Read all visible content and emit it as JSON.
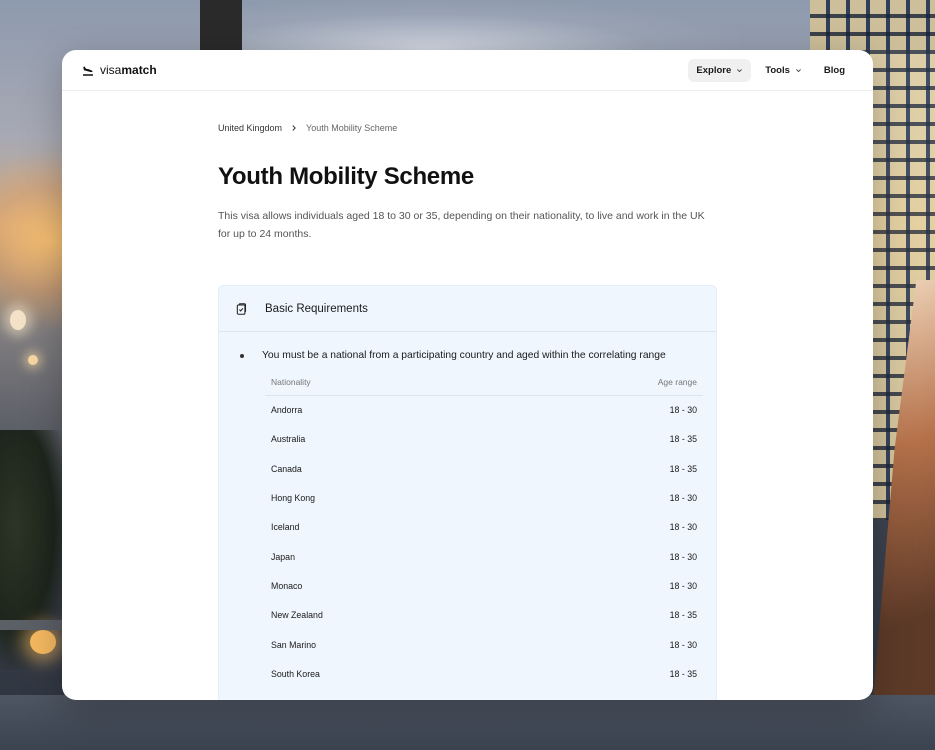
{
  "brand": {
    "name_light": "visa",
    "name_bold": "match"
  },
  "nav": {
    "explore": "Explore",
    "tools": "Tools",
    "blog": "Blog"
  },
  "breadcrumb": {
    "parent": "United Kingdom",
    "current": "Youth Mobility Scheme"
  },
  "page": {
    "title": "Youth Mobility Scheme",
    "description": "This visa allows individuals aged 18 to 30 or 35, depending on their nationality, to live and work in the UK for up to 24 months."
  },
  "requirements": {
    "title": "Basic Requirements",
    "items": [
      {
        "text": "You must be a national from a participating country and aged within the correlating range"
      }
    ],
    "table": {
      "headers": [
        "Nationality",
        "Age range"
      ],
      "rows": [
        [
          "Andorra",
          "18 - 30"
        ],
        [
          "Australia",
          "18 - 35"
        ],
        [
          "Canada",
          "18 - 35"
        ],
        [
          "Hong Kong",
          "18 - 30"
        ],
        [
          "Iceland",
          "18 - 30"
        ],
        [
          "Japan",
          "18 - 30"
        ],
        [
          "Monaco",
          "18 - 30"
        ],
        [
          "New Zealand",
          "18 - 35"
        ],
        [
          "San Marino",
          "18 - 30"
        ],
        [
          "South Korea",
          "18 - 35"
        ]
      ]
    }
  },
  "icons": {
    "logo": "plane-landing-icon",
    "chevron": "chevron-down-icon",
    "breadcrumb_sep": "chevron-right-icon",
    "requirements": "clipboard-check-icon"
  }
}
